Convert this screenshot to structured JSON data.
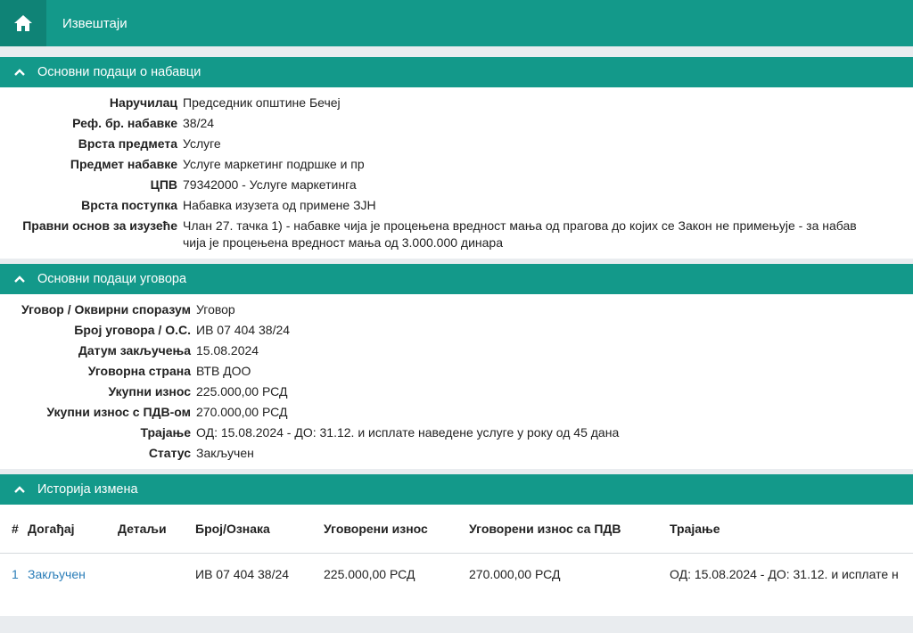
{
  "topbar": {
    "home_icon": "home-icon",
    "title": "Извештаји"
  },
  "colors": {
    "primary": "#13998a",
    "primary_dark": "#0f8376",
    "link": "#2a7db8",
    "background": "#e9ecef"
  },
  "procurement": {
    "header": "Основни подаци о набавци",
    "rows": [
      {
        "label": "Наручилац",
        "value": "Председник општине Бечеј"
      },
      {
        "label": "Реф. бр. набавке",
        "value": "38/24"
      },
      {
        "label": "Врста предмета",
        "value": "Услуге"
      },
      {
        "label": "Предмет набавке",
        "value": "Услуге маркетинг подршке и пр"
      },
      {
        "label": "ЦПВ",
        "value": "79342000 - Услуге маркетинга"
      },
      {
        "label": "Врста поступка",
        "value": "Набавка изузета од примене ЗЈН"
      },
      {
        "label": "Правни основ за изузеће",
        "value": "Члан 27. тачка 1) - набавке чија је процењена вредност мања од прагова до којих се Закон не примењује - за набав",
        "value2": "чија је процењена вредност мања од 3.000.000 динара"
      }
    ]
  },
  "contract": {
    "header": "Основни подаци уговора",
    "rows": [
      {
        "label": "Уговор / Оквирни споразум",
        "value": "Уговор"
      },
      {
        "label": "Број уговора / О.С.",
        "value": "ИВ 07 404 38/24"
      },
      {
        "label": "Датум закључења",
        "value": "15.08.2024"
      },
      {
        "label": "Уговорна страна",
        "value": "ВТВ ДОО"
      },
      {
        "label": "Укупни износ",
        "value": "225.000,00 РСД"
      },
      {
        "label": "Укупни износ с ПДВ-ом",
        "value": "270.000,00 РСД"
      },
      {
        "label": "Трајање",
        "value": "ОД: 15.08.2024 - ДО: 31.12. и исплате наведене услуге у року од 45 дана"
      },
      {
        "label": "Статус",
        "value": "Закључен"
      }
    ]
  },
  "history": {
    "header": "Историја измена",
    "columns": [
      "#",
      "Догађај",
      "Детаљи",
      "Број/Ознака",
      "Уговорени износ",
      "Уговорени износ са ПДВ",
      "Трајање"
    ],
    "rows": [
      {
        "num": "1",
        "event": "Закључен",
        "details": "",
        "number": "ИВ 07 404 38/24",
        "amount": "225.000,00 РСД",
        "amount_vat": "270.000,00 РСД",
        "duration": "ОД: 15.08.2024 - ДО: 31.12. и исплате н"
      }
    ]
  }
}
